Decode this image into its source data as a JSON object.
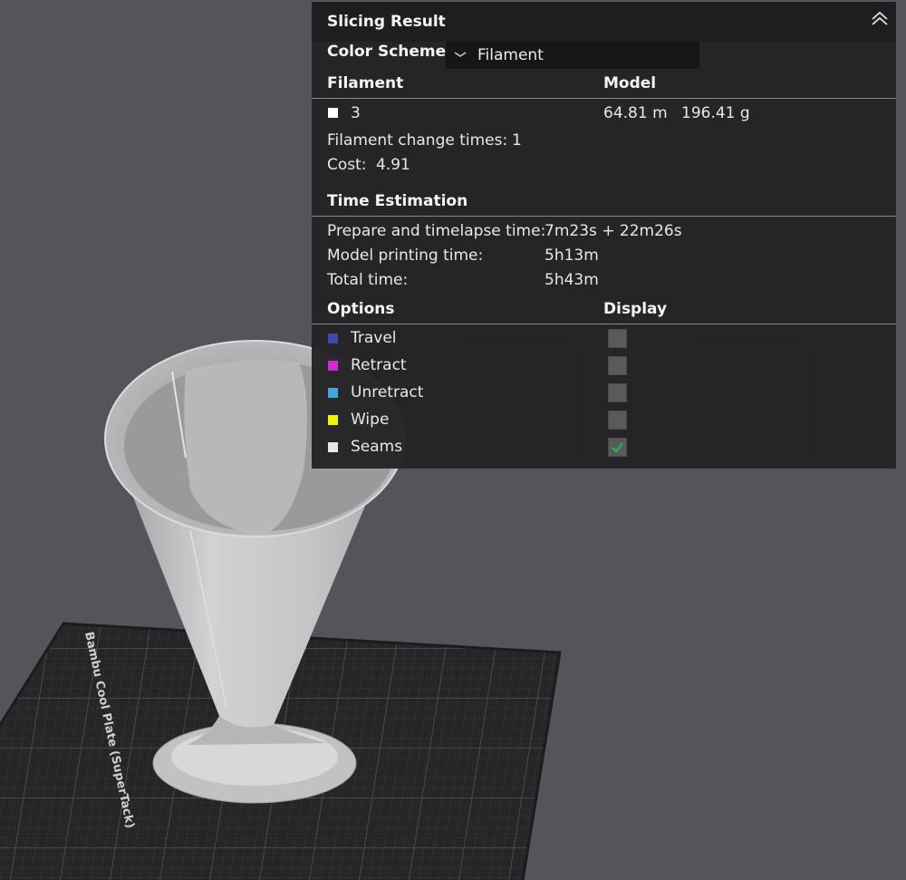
{
  "scene": {
    "plate_label": "Bambu Cool Plate (SuperTack)"
  },
  "panel": {
    "title": "Slicing Result",
    "color_scheme": {
      "label": "Color Scheme",
      "value": "Filament"
    },
    "filament": {
      "header": "Filament",
      "model_header": "Model",
      "items": [
        {
          "id": "3",
          "color": "#ffffff",
          "length": "64.81 m",
          "weight": "196.41 g"
        }
      ],
      "change_times_label": "Filament change times:",
      "change_times_value": "1",
      "cost_label": "Cost:",
      "cost_value": "4.91"
    },
    "time_estimation": {
      "header": "Time Estimation",
      "prepare_label": "Prepare and timelapse time:",
      "prepare_value": "7m23s + 22m26s",
      "model_label": "Model printing time:",
      "model_value": "5h13m",
      "total_label": "Total time:",
      "total_value": "5h43m"
    },
    "options": {
      "header": "Options",
      "display_header": "Display",
      "items": [
        {
          "label": "Travel",
          "color": "#3a4aa8",
          "checked": false
        },
        {
          "label": "Retract",
          "color": "#d62ad6",
          "checked": false
        },
        {
          "label": "Unretract",
          "color": "#3fa8d8",
          "checked": false
        },
        {
          "label": "Wipe",
          "color": "#f2f200",
          "checked": false
        },
        {
          "label": "Seams",
          "color": "#e6e6e6",
          "checked": true
        }
      ]
    }
  }
}
